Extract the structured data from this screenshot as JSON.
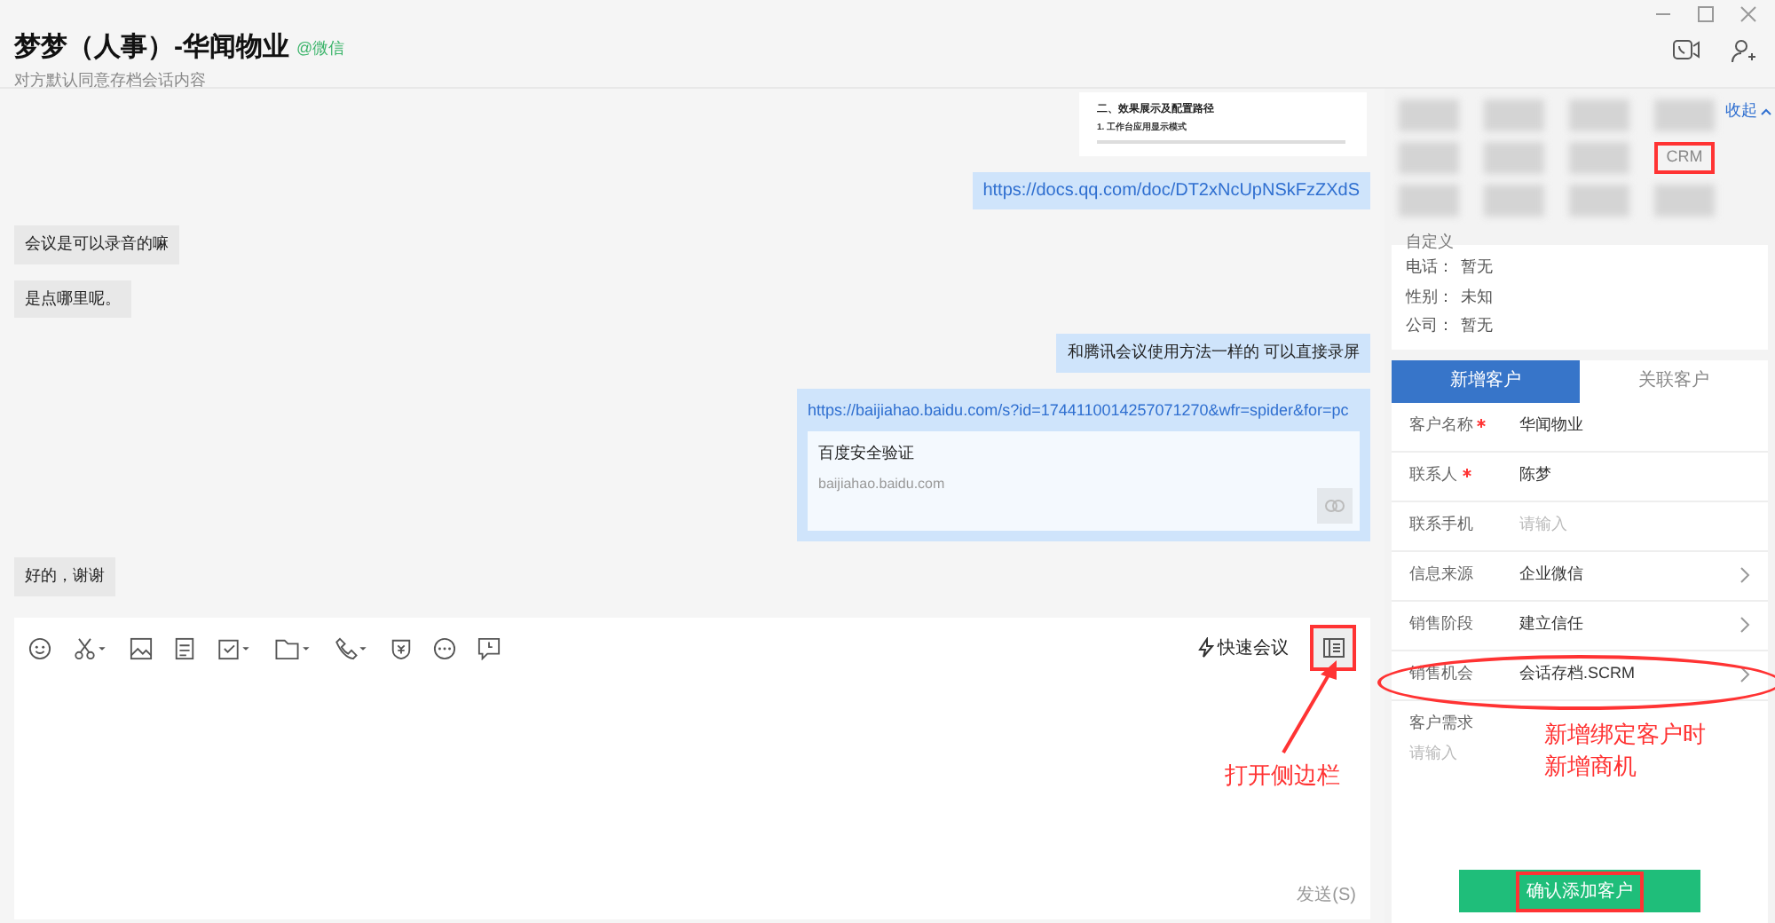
{
  "header": {
    "title": "梦梦（人事）-华闻物业",
    "badge": "@微信",
    "subtitle": "对方默认同意存档会话内容"
  },
  "messages": [
    {
      "kind": "doc_preview",
      "outgoing": true,
      "lines": [
        "二、效果展示及配置路径",
        "1.  工作台应用显示模式"
      ]
    },
    {
      "kind": "link",
      "outgoing": true,
      "text": "https://docs.qq.com/doc/DT2xNcUpNSkFzZXdS"
    },
    {
      "kind": "text",
      "outgoing": false,
      "text": "会议是可以录音的嘛"
    },
    {
      "kind": "text",
      "outgoing": false,
      "text": "是点哪里呢。"
    },
    {
      "kind": "text",
      "outgoing": true,
      "text": "和腾讯会议使用方法一样的 可以直接录屏"
    },
    {
      "kind": "link_card",
      "outgoing": true,
      "url": "https://baijiahao.baidu.com/s?id=1744110014257071270&wfr=spider&for=pc",
      "card_title": "百度安全验证",
      "card_domain": "baijiahao.baidu.com"
    },
    {
      "kind": "text",
      "outgoing": false,
      "text": "好的，谢谢"
    }
  ],
  "composer": {
    "quick_meeting": "快速会议",
    "sidebar_toggle": {
      "highlighted": true
    },
    "send": "发送(S)",
    "annotation": "打开侧边栏"
  },
  "sidebar": {
    "collapse": "收起",
    "apps": [
      {
        "kind": "blurred"
      },
      {
        "kind": "blurred"
      },
      {
        "kind": "blurred"
      },
      {
        "kind": "blurred"
      },
      {
        "kind": "blurred"
      },
      {
        "kind": "blurred"
      },
      {
        "kind": "blurred"
      },
      {
        "kind": "label",
        "text": "CRM",
        "highlighted": true
      },
      {
        "kind": "blurred"
      },
      {
        "kind": "blurred"
      },
      {
        "kind": "blurred"
      },
      {
        "kind": "blurred"
      }
    ],
    "customize": "自定义",
    "info": [
      {
        "label": "电话：",
        "value": "暂无"
      },
      {
        "label": "性别：",
        "value": "未知"
      },
      {
        "label": "公司：",
        "value": "暂无"
      }
    ],
    "tabs": [
      {
        "label": "新增客户",
        "selected": true
      },
      {
        "label": "关联客户",
        "selected": false
      }
    ],
    "form": [
      {
        "kind": "text",
        "label": "客户名称",
        "required": true,
        "value": "华闻物业",
        "circled": false
      },
      {
        "kind": "text",
        "label": "联系人",
        "required": true,
        "value": "陈梦",
        "circled": false
      },
      {
        "kind": "input",
        "label": "联系手机",
        "required": false,
        "placeholder": "请输入",
        "circled": false
      },
      {
        "kind": "select",
        "label": "信息来源",
        "required": false,
        "value": "企业微信",
        "circled": false
      },
      {
        "kind": "select",
        "label": "销售阶段",
        "required": false,
        "value": "建立信任",
        "circled": false
      },
      {
        "kind": "select",
        "label": "销售机会",
        "required": false,
        "value": "会话存档.SCRM",
        "circled": true
      },
      {
        "kind": "textarea",
        "label": "客户需求",
        "required": false,
        "placeholder": "请输入",
        "circled": false
      }
    ],
    "annotation": [
      "新增绑定客户时",
      "新增商机"
    ],
    "confirm": {
      "label": "确认添加客户",
      "highlighted": true
    }
  }
}
